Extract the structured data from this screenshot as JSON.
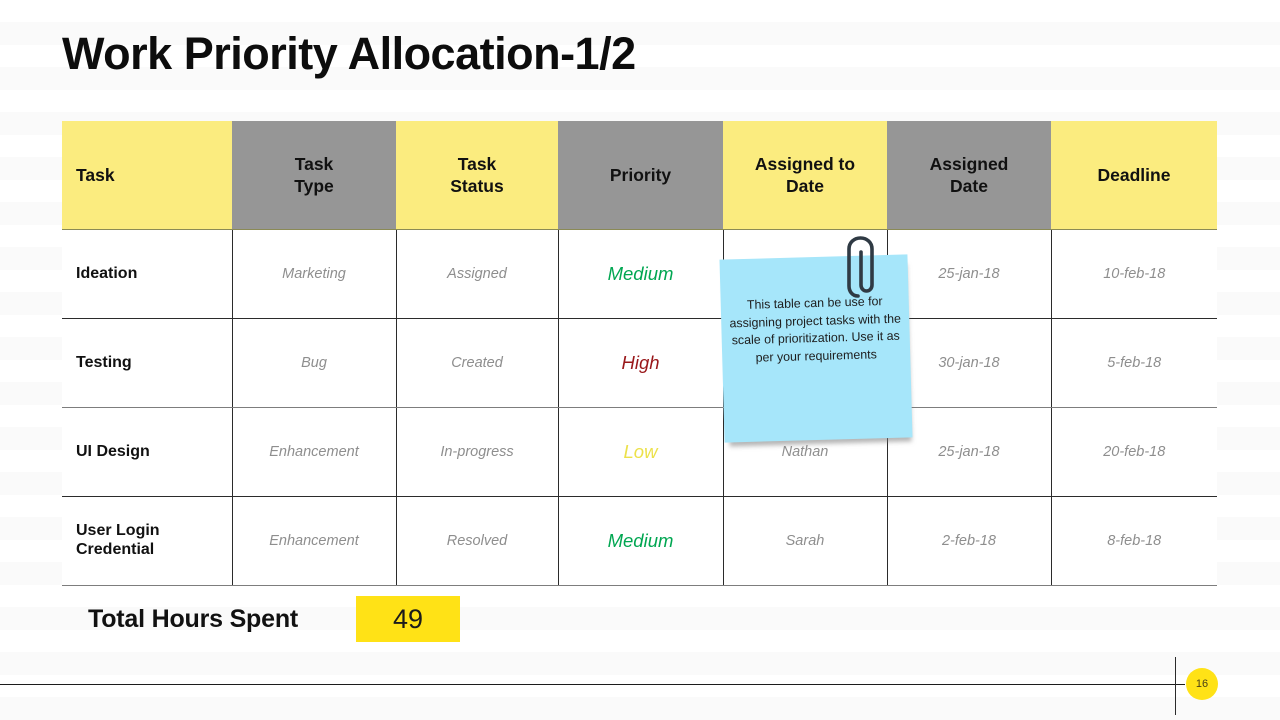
{
  "slide": {
    "title": "Work Priority Allocation-1/2",
    "page_number": "16"
  },
  "theme": {
    "header_yellow": "#FBEC7F",
    "header_gray": "#969696",
    "accent_yellow": "#FFE216",
    "sticky_blue": "#A6E6FA",
    "priority_medium": "#00A651",
    "priority_high": "#99171A",
    "priority_low": "#ECE14A",
    "body_text_gray": "#8E8E8E"
  },
  "table": {
    "columns": [
      {
        "label": "Task",
        "style": "yellow",
        "align": "left"
      },
      {
        "label": "Task\nType",
        "line1": "Task",
        "line2": "Type",
        "style": "gray",
        "align": "center"
      },
      {
        "label": "Task\nStatus",
        "line1": "Task",
        "line2": "Status",
        "style": "yellow",
        "align": "center"
      },
      {
        "label": "Priority",
        "line1": "Priority",
        "line2": "",
        "style": "gray",
        "align": "center"
      },
      {
        "label": "Assigned to\nDate",
        "line1": "Assigned to",
        "line2": "Date",
        "style": "yellow",
        "align": "center"
      },
      {
        "label": "Assigned\nDate",
        "line1": "Assigned",
        "line2": "Date",
        "style": "gray",
        "align": "center"
      },
      {
        "label": "Deadline",
        "line1": "Deadline",
        "line2": "",
        "style": "yellow",
        "align": "center"
      }
    ],
    "rows": [
      {
        "task": "Ideation",
        "task_type": "Marketing",
        "task_status": "Assigned",
        "priority": "Medium",
        "priority_level": "medium",
        "assigned_to_date": "",
        "assigned_date": "25-jan-18",
        "deadline": "10-feb-18"
      },
      {
        "task": "Testing",
        "task_type": "Bug",
        "task_status": "Created",
        "priority": "High",
        "priority_level": "high",
        "assigned_to_date": "",
        "assigned_date": "30-jan-18",
        "deadline": "5-feb-18"
      },
      {
        "task": "UI Design",
        "task_type": "Enhancement",
        "task_status": "In-progress",
        "priority": "Low",
        "priority_level": "low",
        "assigned_to_date": "Nathan",
        "assigned_date": "25-jan-18",
        "deadline": "20-feb-18"
      },
      {
        "task_line1": "User Login",
        "task_line2": "Credential",
        "task": "User Login Credential",
        "task_type": "Enhancement",
        "task_status": "Resolved",
        "priority": "Medium",
        "priority_level": "medium",
        "assigned_to_date": "Sarah",
        "assigned_date": "2-feb-18",
        "deadline": "8-feb-18"
      }
    ]
  },
  "sticky_note": {
    "text": "This table can be use for assigning project tasks with the scale of prioritization. Use it as per your requirements",
    "icon": "paperclip-icon"
  },
  "summary": {
    "label": "Total Hours Spent",
    "value": "49"
  }
}
